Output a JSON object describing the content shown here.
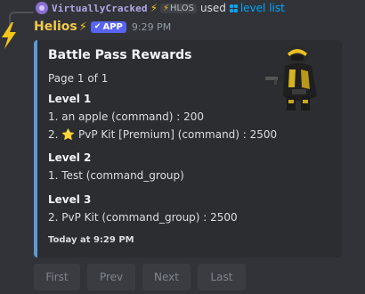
{
  "reply": {
    "username": "VirtuallyCracked",
    "tag": "HLOS",
    "used_text": "used",
    "command": "level list"
  },
  "message": {
    "bot_name": "Helios",
    "app_badge": "APP",
    "timestamp": "9:29 PM"
  },
  "embed": {
    "accent_color": "#5b9bd5",
    "title": "Battle Pass Rewards",
    "page": "Page 1 of 1",
    "levels": [
      {
        "title": "Level 1",
        "lines": [
          {
            "text": "1. an apple (command) : 200"
          },
          {
            "prefix": "2. ",
            "emoji": "⭐",
            "text": " PvP Kit [Premium] (command) : 2500"
          }
        ]
      },
      {
        "title": "Level 2",
        "lines": [
          {
            "text": "1. Test (command_group)"
          }
        ]
      },
      {
        "title": "Level 3",
        "lines": [
          {
            "text": "2. PvP Kit (command_group) : 2500"
          }
        ]
      }
    ],
    "footer": "Today at 9:29 PM"
  },
  "buttons": [
    {
      "label": "First",
      "disabled": true
    },
    {
      "label": "Prev",
      "disabled": true
    },
    {
      "label": "Next",
      "disabled": true
    },
    {
      "label": "Last",
      "disabled": true
    }
  ]
}
